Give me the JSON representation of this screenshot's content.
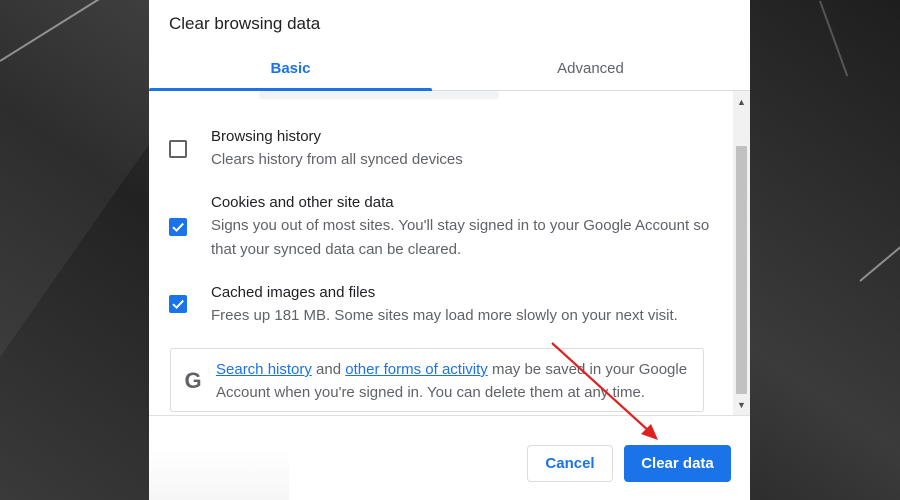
{
  "dialog": {
    "title": "Clear browsing data"
  },
  "tabs": [
    {
      "label": "Basic",
      "active": true
    },
    {
      "label": "Advanced",
      "active": false
    }
  ],
  "items": [
    {
      "title": "Browsing history",
      "description": "Clears history from all synced devices",
      "checked": false
    },
    {
      "title": "Cookies and other site data",
      "description": "Signs you out of most sites. You'll stay signed in to your Google Account so that your synced data can be cleared.",
      "checked": true
    },
    {
      "title": "Cached images and files",
      "description": "Frees up 181 MB. Some sites may load more slowly on your next visit.",
      "checked": true
    }
  ],
  "google_notice": {
    "icon": "G",
    "link1": "Search history",
    "and": " and ",
    "link2": "other forms of activity",
    "rest": " may be saved in your Google Account when you're signed in. You can delete them at any time."
  },
  "buttons": {
    "cancel": "Cancel",
    "clear": "Clear data"
  },
  "colors": {
    "accent": "#1a73e8",
    "annotation_arrow": "#e02020"
  }
}
